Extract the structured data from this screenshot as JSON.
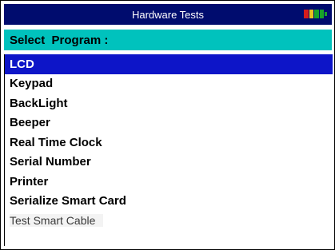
{
  "window": {
    "title": "Hardware Tests"
  },
  "battery": {
    "colors": [
      "#d61c1c",
      "#e9c31f",
      "#18a32a",
      "#18a32a"
    ]
  },
  "header": {
    "label": "Select  Program :"
  },
  "menu": {
    "items": [
      {
        "label": "LCD",
        "selected": true
      },
      {
        "label": "Keypad"
      },
      {
        "label": "BackLight"
      },
      {
        "label": "Beeper"
      },
      {
        "label": "Real Time Clock"
      },
      {
        "label": "Serial Number"
      },
      {
        "label": "Printer"
      },
      {
        "label": "Serialize Smart Card"
      },
      {
        "label": "Test Smart Cable",
        "disabled": true
      }
    ]
  },
  "colors": {
    "titlebar": "#000c6e",
    "header": "#00c2bd",
    "selection": "#0d15c8"
  }
}
